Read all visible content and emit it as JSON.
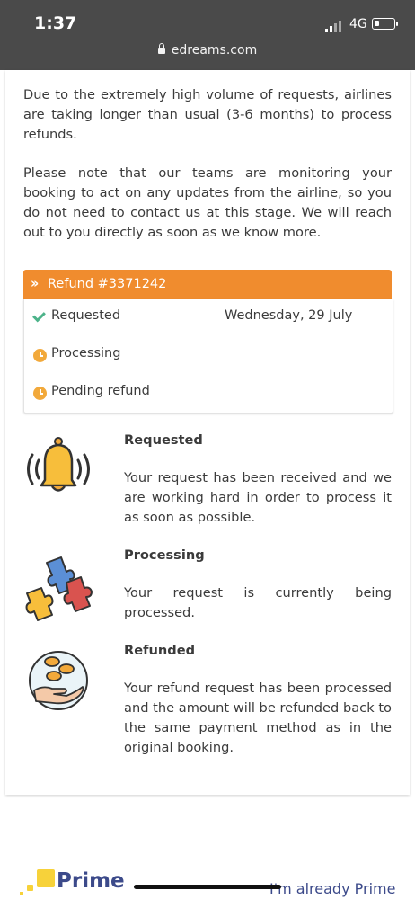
{
  "status_bar": {
    "time": "1:37",
    "network": "4G"
  },
  "browser": {
    "url": "edreams.com"
  },
  "notice": {
    "paragraph1": "Due to the extremely high volume of requests, airlines are taking longer than usual (3-6 months) to process refunds.",
    "paragraph2": "Please note that our teams are monitoring your booking to act on any updates from the airline, so you do not need to contact us at this stage. We will reach out to you directly as soon as we know more."
  },
  "refund": {
    "title": "Refund #3371242",
    "steps": [
      {
        "label": "Requested",
        "icon": "check-icon",
        "date": "Wednesday, 29 July"
      },
      {
        "label": "Processing",
        "icon": "clock-icon"
      },
      {
        "label": "Pending refund",
        "icon": "clock-icon"
      }
    ]
  },
  "info": [
    {
      "title": "Requested",
      "text": "Your request has been received and we are working hard in order to process it as soon as possible.",
      "icon": "bell-icon"
    },
    {
      "title": "Processing",
      "text": "Your request is currently being processed.",
      "icon": "puzzle-icon"
    },
    {
      "title": "Refunded",
      "text": "Your refund request has been processed and the amount will be refunded back to the same payment method as in the original booking.",
      "icon": "coins-hand-icon"
    }
  ],
  "footer": {
    "prime_label": "Prime",
    "already_prime_link": "I'm already Prime"
  },
  "colors": {
    "header_bg": "#4a4a4a",
    "accent_orange": "#f08c2e",
    "check_green": "#4db38a",
    "clock_orange": "#f2a93b",
    "prime_blue": "#3c4a8a",
    "prime_yellow": "#f7d23a"
  }
}
